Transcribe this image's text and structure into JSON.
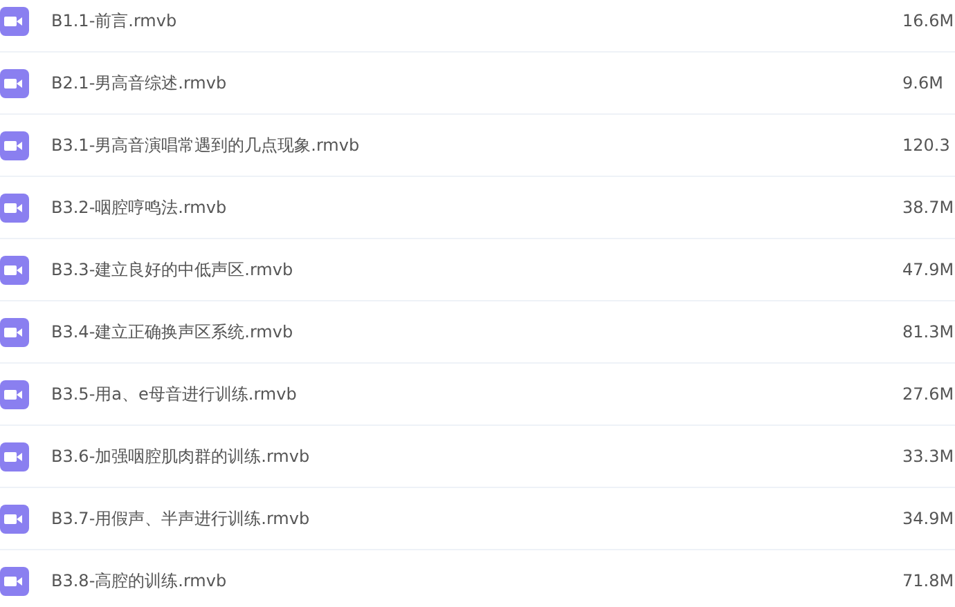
{
  "files": [
    {
      "name": "B1.1-前言.rmvb",
      "size": "16.6M"
    },
    {
      "name": "B2.1-男高音综述.rmvb",
      "size": "9.6M"
    },
    {
      "name": "B3.1-男高音演唱常遇到的几点现象.rmvb",
      "size": "120.3"
    },
    {
      "name": "B3.2-咽腔哼鸣法.rmvb",
      "size": "38.7M"
    },
    {
      "name": "B3.3-建立良好的中低声区.rmvb",
      "size": "47.9M"
    },
    {
      "name": "B3.4-建立正确换声区系统.rmvb",
      "size": "81.3M"
    },
    {
      "name": "B3.5-用a、e母音进行训练.rmvb",
      "size": "27.6M"
    },
    {
      "name": "B3.6-加强咽腔肌肉群的训练.rmvb",
      "size": "33.3M"
    },
    {
      "name": "B3.7-用假声、半声进行训练.rmvb",
      "size": "34.9M"
    },
    {
      "name": "B3.8-高腔的训练.rmvb",
      "size": "71.8M"
    }
  ]
}
